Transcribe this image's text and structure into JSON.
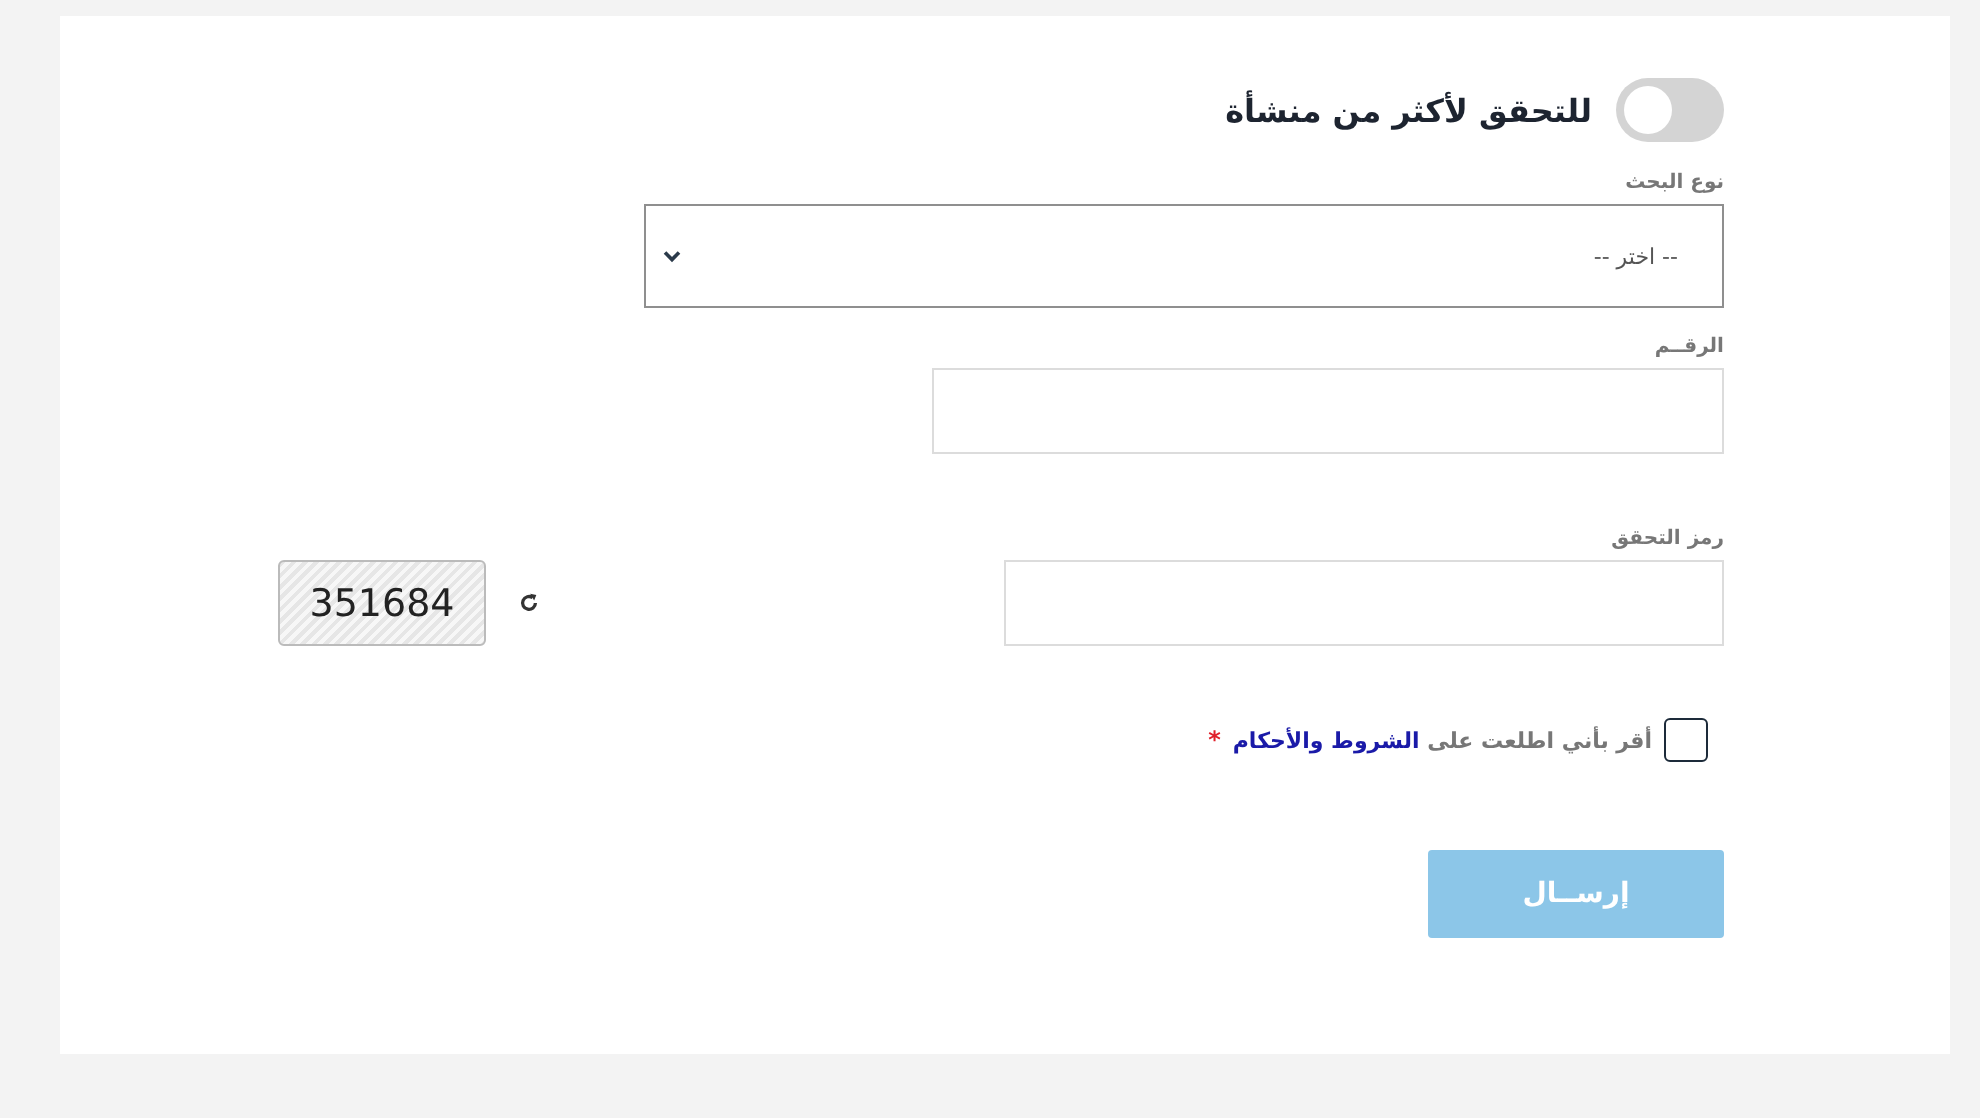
{
  "toggle": {
    "label": "للتحقق لأكثر من منشأة",
    "on": false
  },
  "search_type": {
    "label": "نوع البحث",
    "value": "-- اختر --"
  },
  "number": {
    "label": "الرقــم"
  },
  "captcha": {
    "label": "رمز التحقق",
    "code": "351684"
  },
  "terms": {
    "text": "أقر بأني اطلعت على",
    "link": "الشروط والأحكام",
    "required": "*",
    "checked": false
  },
  "submit": {
    "label": "إرســال",
    "disabled": true
  }
}
